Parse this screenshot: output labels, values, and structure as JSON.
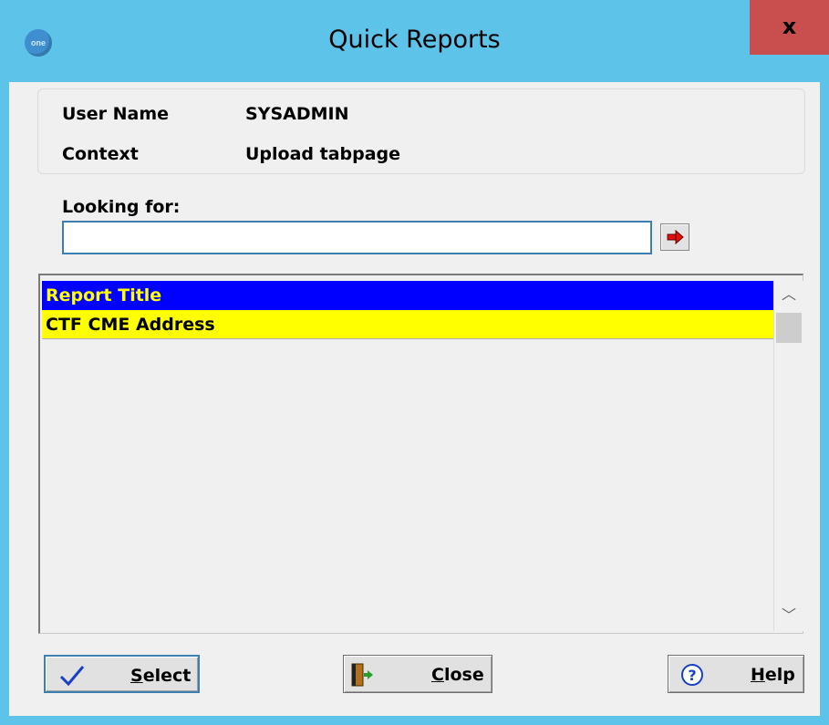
{
  "window": {
    "title": "Quick Reports",
    "app_icon_text": "one",
    "close_glyph": "x"
  },
  "info": {
    "user_name_label": "User Name",
    "user_name_value": "SYSADMIN",
    "context_label": "Context",
    "context_value": "Upload tabpage"
  },
  "search": {
    "label": "Looking for:",
    "value": "",
    "go_icon": "red-arrow-right-icon"
  },
  "list": {
    "header": "Report Title",
    "rows": [
      "CTF CME Address"
    ],
    "colors": {
      "header_bg": "#0000ff",
      "header_text": "#ffff00",
      "row_bg": "#ffff00"
    }
  },
  "buttons": {
    "select": "Select",
    "close": "Close",
    "help": "Help"
  },
  "colors": {
    "titlebar": "#5ec3e8",
    "close_button": "#c94f4f"
  }
}
